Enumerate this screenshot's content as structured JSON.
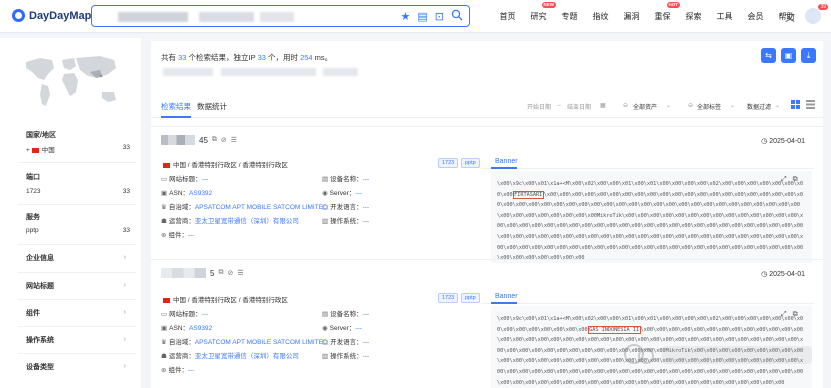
{
  "app": {
    "logo_text": "DayDayMap",
    "brand_color": "#2f6bff"
  },
  "search": {
    "icons": [
      "star-icon",
      "clipboard-icon",
      "camera-icon",
      "search-icon"
    ]
  },
  "nav": {
    "items": [
      {
        "label": "首页"
      },
      {
        "label": "研究",
        "badge": "NEW"
      },
      {
        "label": "专题"
      },
      {
        "label": "指纹"
      },
      {
        "label": "漏洞"
      },
      {
        "label": "重保",
        "badge": "HOT"
      },
      {
        "label": "探索"
      },
      {
        "label": "工具"
      },
      {
        "label": "会员"
      },
      {
        "label": "帮助"
      }
    ],
    "notification_count": "39"
  },
  "sidebar": {
    "country_title": "国家/地区",
    "country_name": "中国",
    "country_count": "33",
    "port_title": "端口",
    "port_value": "1723",
    "port_count": "33",
    "service_title": "服务",
    "service_value": "pptp",
    "service_count": "33",
    "collapsed": [
      "企业信息",
      "网站标题",
      "组件",
      "操作系统",
      "设备类型"
    ]
  },
  "summary": {
    "p1": "共有 ",
    "results": "33",
    "p2": " 个检索结果，独立IP ",
    "ips": "33",
    "p3": " 个，用时 ",
    "ms": "254",
    "p4": " ms。"
  },
  "tabs": {
    "results": "检索结果",
    "stats": "数据统计"
  },
  "toolbar": {
    "start_date": "开始日期",
    "arrow": "→",
    "end_date": "结束日期",
    "all_assets": "全部资产",
    "all_tags": "全部标签",
    "data_filter": "数据过滤"
  },
  "cards": [
    {
      "ip_suffix": "45",
      "date": "2025-04-01",
      "location": "中国 / 香港特别行政区 / 香港特别行政区",
      "port": "1723",
      "protocol": "pptp",
      "site_title_label": "网站标题：",
      "site_title_value": "---",
      "asn_label": "ASN：",
      "asn_value": "AS9392",
      "org_label": "自治域：",
      "org_value": "APSATCOM APT MOBILE SATCOM LIMITED",
      "isp_label": "运营商：",
      "isp_value": "亚太卫星宽带通信（深圳）有限公司",
      "component_label": "组件：",
      "component_value": "---",
      "device_label": "设备名称：",
      "device_value": "---",
      "server_label": "Server：",
      "server_value": "---",
      "lang_label": "开发语言：",
      "lang_value": "---",
      "os_label": "操作系统：",
      "os_value": "---",
      "banner_tab": "Banner",
      "banner_pre": "\\x00\\x9c\\x00\\x01\\x1a+<M\\x00\\x02\\x00\\x00\\x01\\x00\\x01\\x00\\x00\\x00\\x00\\x02\\x00\\x00\\x00\\x00\\x00\\x00\\x00\\x00",
      "banner_mark": "FIRTASARI",
      "banner_post": "\\x00\\x00\\x00\\x00\\x00\\x00\\x00\\x00\\x00\\x00\\x00\\x00\\x00\\x00\\x00\\x00\\x00\\x00\\x00\\x00\\x00\\x00\\x00\\x00\\x00\\x00\\x00\\x00\\x00\\x00\\x00\\x00\\x00\\x00\\x00\\x00\\x00\\x00\\x00\\x00\\x00\\x00\\x00\\x00\\x00\\x00\\x00\\x00\\x00\\x00\\x00\\x00\\x00MikroTik\\x00\\x00\\x00\\x00\\x00\\x00\\x00\\x00\\x00\\x00\\x00\\x00\\x00\\x00\\x00\\x00\\x00\\x00\\x00\\x00\\x00\\x00\\x00\\x00\\x00\\x00\\x00\\x00\\x00\\x00\\x00\\x00\\x00\\x00\\x00\\x00\\x00\\x00\\x00\\x00\\x00\\x00\\x00\\x00\\x00\\x00\\x00\\x00\\x00\\x00\\x00\\x00\\x00\\x00\\x00\\x00\\x00\\x00\\x00\\x00\\x00\\x00\\x00\\x00\\x00\\x00\\x00\\x00\\x00\\x00\\x00\\x00\\x00\\x00\\x00\\x00\\x00\\x00\\x00\\x00\\x00\\x00\\x00\\x00\\x00\\x00\\x00\\x00\\x00\\x00\\x00\\x00\\x00\\x00\\x00"
    },
    {
      "ip_suffix": "5",
      "date": "2025-04-01",
      "location": "中国 / 香港特别行政区 / 香港特别行政区",
      "port": "1723",
      "protocol": "pptp",
      "site_title_label": "网站标题：",
      "site_title_value": "---",
      "asn_label": "ASN：",
      "asn_value": "AS9392",
      "org_label": "自治域：",
      "org_value": "APSATCOM APT MOBILE SATCOM LIMITED",
      "isp_label": "运营商：",
      "isp_value": "亚太卫星宽带通信（深圳）有限公司",
      "component_label": "组件：",
      "component_value": "---",
      "device_label": "设备名称：",
      "device_value": "---",
      "server_label": "Server：",
      "server_value": "---",
      "lang_label": "开发语言：",
      "lang_value": "---",
      "os_label": "操作系统：",
      "os_value": "---",
      "banner_tab": "Banner",
      "banner_pre": "\\x00\\x9c\\x00\\x01\\x1a+<M\\x00\\x02\\x00\\x00\\x01\\x00\\x01\\x00\\x00\\x00\\x00\\x02\\x00\\x00\\x00\\x00\\x00\\x00\\x00\\x00\\x00\\x00\\x00\\x00\\x00\\x00",
      "banner_mark": "GAS INDONESIA II",
      "banner_post": "\\x00\\x00\\x00\\x00\\x00\\x00\\x00\\x00\\x00\\x00\\x00\\x00\\x00\\x00\\x00\\x00\\x00\\x00\\x00\\x00\\x00\\x00\\x00\\x00\\x00\\x00\\x00\\x00\\x00\\x00\\x00\\x00\\x00\\x00\\x00\\x00\\x00\\x00\\x00\\x00\\x00\\x00\\x00\\x00\\x00\\x00\\x00\\x00\\x00\\x00\\x00MikroTik\\x00\\x00\\x00\\x00\\x00\\x00\\x00\\x00\\x00\\x00\\x00\\x00\\x00\\x00\\x00\\x00\\x00\\x00\\x00\\x00\\x00\\x00\\x00\\x00\\x00\\x00\\x00\\x00\\x00\\x00\\x00\\x00\\x00\\x00\\x00\\x00\\x00\\x00\\x00\\x00\\x00\\x00\\x00\\x00\\x00\\x00\\x00\\x00\\x00\\x00\\x00\\x00\\x00\\x00\\x00\\x00\\x00\\x00\\x00\\x00\\x00\\x00\\x00\\x00\\x00\\x00\\x00\\x00\\x00\\x00\\x00\\x00\\x00\\x00\\x00\\x00\\x00\\x00\\x00\\x00\\x00"
    }
  ]
}
